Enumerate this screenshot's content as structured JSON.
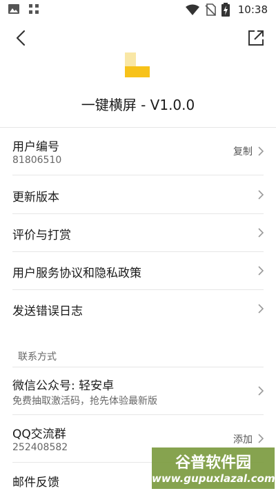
{
  "status_bar": {
    "time": "10:38",
    "icons": [
      "image-icon",
      "qr-grid-icon",
      "wifi-icon",
      "no-sim-icon",
      "battery-charging-icon"
    ]
  },
  "header": {
    "title": "一键横屏 - V1.0.0",
    "back_icon": "back-arrow-icon",
    "share_icon": "open-external-icon",
    "logo_colors": {
      "top": "#f9e7a6",
      "bottom": "#f7c21a"
    }
  },
  "rows": {
    "user_id": {
      "title": "用户编号",
      "value": "81806510",
      "action": "复制"
    },
    "update": {
      "title": "更新版本"
    },
    "rate": {
      "title": "评价与打赏"
    },
    "policy": {
      "title": "用户服务协议和隐私政策"
    },
    "send_log": {
      "title": "发送错误日志"
    }
  },
  "contact": {
    "section_label": "联系方式",
    "wechat": {
      "title": "微信公众号: 轻安卓",
      "subtitle": "免费抽取激活码，抢先体验最新版"
    },
    "qq_group": {
      "title": "QQ交流群",
      "value": "252408582",
      "action": "添加"
    },
    "email": {
      "title": "邮件反馈"
    }
  },
  "watermark": {
    "line1": "谷普软件园",
    "line2": "www.gupuxlazal.com"
  }
}
